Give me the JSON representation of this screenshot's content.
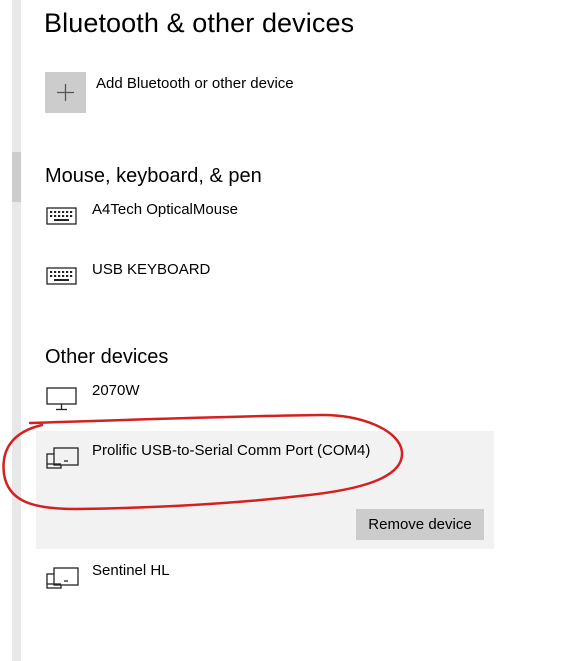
{
  "page": {
    "title": "Bluetooth & other devices"
  },
  "add_device": {
    "label": "Add Bluetooth or other device",
    "icon": "plus-icon"
  },
  "sections": {
    "mouse_keyboard_pen": {
      "heading": "Mouse, keyboard, & pen",
      "devices": [
        {
          "name": "A4Tech OpticalMouse",
          "icon": "keyboard-icon"
        },
        {
          "name": "USB KEYBOARD",
          "icon": "keyboard-icon"
        }
      ]
    },
    "other_devices": {
      "heading": "Other devices",
      "devices": [
        {
          "name": "2070W",
          "icon": "monitor-icon"
        },
        {
          "name": "Prolific USB-to-Serial Comm Port (COM4)",
          "icon": "device-icon",
          "selected": true
        },
        {
          "name": "Sentinel HL",
          "icon": "device-icon"
        }
      ]
    }
  },
  "selected_device": {
    "remove_label": "Remove device"
  },
  "colors": {
    "background": "#ffffff",
    "tile": "#cccccc",
    "selected_panel": "#f2f2f2",
    "annotation": "#d42020"
  }
}
